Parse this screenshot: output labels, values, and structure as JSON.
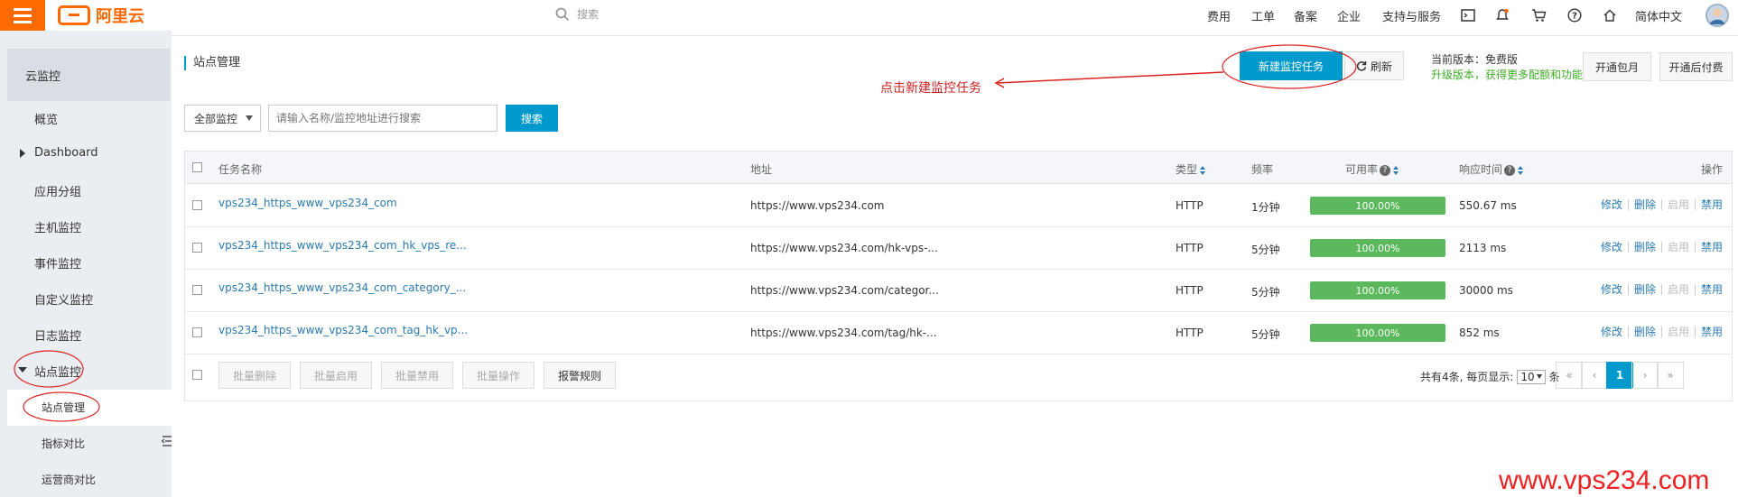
{
  "topbar": {
    "logo_text": "阿里云",
    "search_placeholder": "搜索",
    "nav": [
      "费用",
      "工单",
      "备案",
      "企业",
      "支持与服务"
    ],
    "lang": "简体中文",
    "accent": "#ff6a00"
  },
  "sidebar": {
    "title": "云监控",
    "items": [
      "概览",
      "Dashboard",
      "应用分组",
      "主机监控",
      "事件监控",
      "自定义监控",
      "日志监控",
      "站点监控"
    ],
    "sub_items": [
      "站点管理",
      "指标对比",
      "运营商对比"
    ]
  },
  "main": {
    "page_title": "站点管理",
    "new_task_label": "新建监控任务",
    "refresh_label": "刷新",
    "version_label": "当前版本：免费版",
    "upgrade_text": "升级版本，获得更多配额和功能",
    "monthly_label": "开通包月",
    "postpaid_label": "开通后付费",
    "annotation": "点击新建监控任务",
    "filter_select": "全部监控",
    "search_placeholder": "请输入名称/监控地址进行搜索",
    "search_button": "搜索",
    "primary_color": "#0099cc"
  },
  "table": {
    "headers": {
      "name": "任务名称",
      "address": "地址",
      "type": "类型",
      "freq": "频率",
      "availability": "可用率",
      "response": "响应时间",
      "ops": "操作"
    },
    "rows": [
      {
        "name": "vps234_https_www_vps234_com",
        "address": "https://www.vps234.com",
        "type": "HTTP",
        "freq": "1分钟",
        "availability": "100.00%",
        "response": "550.67 ms"
      },
      {
        "name": "vps234_https_www_vps234_com_hk_vps_re...",
        "address": "https://www.vps234.com/hk-vps-...",
        "type": "HTTP",
        "freq": "5分钟",
        "availability": "100.00%",
        "response": "2113 ms"
      },
      {
        "name": "vps234_https_www_vps234_com_category_...",
        "address": "https://www.vps234.com/categor...",
        "type": "HTTP",
        "freq": "5分钟",
        "availability": "100.00%",
        "response": "30000 ms"
      },
      {
        "name": "vps234_https_www_vps234_com_tag_hk_vp...",
        "address": "https://www.vps234.com/tag/hk-...",
        "type": "HTTP",
        "freq": "5分钟",
        "availability": "100.00%",
        "response": "852 ms"
      }
    ],
    "row_ops": [
      "修改",
      "删除",
      "启用",
      "禁用"
    ],
    "bar_color": "#5cb85c"
  },
  "footer": {
    "batch_delete": "批量删除",
    "batch_enable": "批量启用",
    "batch_disable": "批量禁用",
    "batch_ops": "批量操作",
    "alarm_rules": "报警规则",
    "total_text": "共有4条, 每页显示:",
    "page_size": "10",
    "page_size_suffix": "条",
    "current_page": "1",
    "pager_first": "«",
    "pager_prev": "‹",
    "pager_next": "›",
    "pager_last": "»"
  },
  "watermark": "www.vps234.com"
}
